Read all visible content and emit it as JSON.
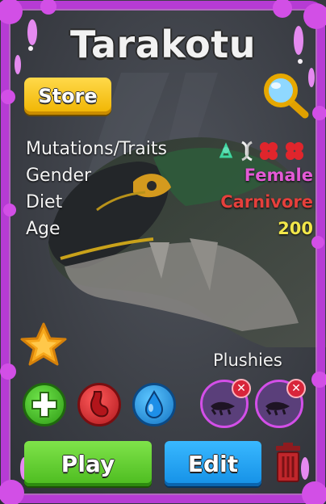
{
  "title": "Tarakotu",
  "store_label": "Store",
  "stats": [
    {
      "label": "Mutations/Traits",
      "value": ""
    },
    {
      "label": "Gender",
      "value": "Female",
      "color": "#e45ad6"
    },
    {
      "label": "Diet",
      "value": "Carnivore",
      "color": "#e5403c"
    },
    {
      "label": "Age",
      "value": "200",
      "color": "#f2e74a"
    }
  ],
  "trait_icons": [
    "green-creature-icon",
    "dna-icon",
    "red-cell-icon",
    "red-cell-icon"
  ],
  "plushies_label": "Plushies",
  "actions": {
    "play_label": "Play",
    "edit_label": "Edit"
  },
  "icons": [
    "magnifier-icon",
    "star-icon",
    "heal-plus-icon",
    "stomach-icon",
    "water-drop-icon",
    "plushie-icon",
    "remove-x-icon",
    "trash-icon"
  ],
  "colors": {
    "frame": "#c23fdc",
    "store": "#f7c51c",
    "play": "#5ccb2a",
    "edit": "#1ea2f5",
    "trash": "#c0262b"
  }
}
